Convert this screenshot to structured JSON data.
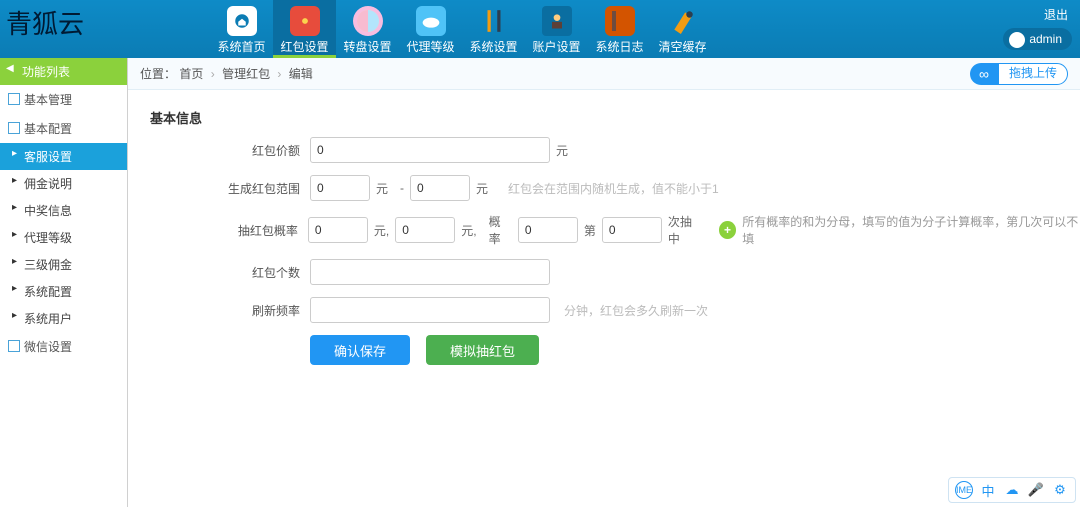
{
  "brand": "青狐云",
  "header": {
    "logout": "退出",
    "admin": "admin",
    "nav": [
      {
        "label": "系统首页",
        "icon": "home-icon",
        "active": false
      },
      {
        "label": "红包设置",
        "icon": "redpack-icon",
        "active": true
      },
      {
        "label": "转盘设置",
        "icon": "wheel-icon",
        "active": false
      },
      {
        "label": "代理等级",
        "icon": "cloud-icon",
        "active": false
      },
      {
        "label": "系统设置",
        "icon": "tools-icon",
        "active": false
      },
      {
        "label": "账户设置",
        "icon": "account-icon",
        "active": false
      },
      {
        "label": "系统日志",
        "icon": "log-icon",
        "active": false
      },
      {
        "label": "清空缓存",
        "icon": "clear-icon",
        "active": false
      }
    ]
  },
  "sidebar": {
    "title": "功能列表",
    "groups": [
      {
        "label": "基本管理",
        "type": "group"
      },
      {
        "label": "基本配置",
        "type": "group"
      },
      {
        "label": "客服设置",
        "type": "item",
        "active": true
      },
      {
        "label": "佣金说明",
        "type": "item"
      },
      {
        "label": "中奖信息",
        "type": "item"
      },
      {
        "label": "代理等级",
        "type": "item"
      },
      {
        "label": "三级佣金",
        "type": "item"
      },
      {
        "label": "系统配置",
        "type": "item"
      },
      {
        "label": "系统用户",
        "type": "item"
      },
      {
        "label": "微信设置",
        "type": "group"
      }
    ]
  },
  "crumb": {
    "label": "位置：",
    "parts": [
      "首页",
      "管理红包",
      "编辑"
    ]
  },
  "upload": {
    "label": "拖拽上传"
  },
  "form": {
    "section_title": "基本信息",
    "price": {
      "label": "红包价额",
      "value": "0",
      "unit": "元"
    },
    "range": {
      "label": "生成红包范围",
      "min": "0",
      "max": "0",
      "unit": "元",
      "sep": "-",
      "hint": "红包会在范围内随机生成，值不能小于1"
    },
    "rate": {
      "label": "抽红包概率",
      "a": "0",
      "b": "0",
      "unit": "元,",
      "prob_label": "概率",
      "prob": "0",
      "nth_label": "第",
      "nth": "0",
      "tail": "次抽中",
      "hint": "所有概率的和为分母，填写的值为分子计算概率，第几次可以不填"
    },
    "count": {
      "label": "红包个数",
      "value": ""
    },
    "refresh": {
      "label": "刷新频率",
      "value": "",
      "hint": "分钟，红包会多久刷新一次"
    },
    "save_label": "确认保存",
    "simulate_label": "模拟抽红包"
  },
  "floatbar": [
    "IME",
    "中",
    "☁",
    "🎤",
    "⚙"
  ]
}
